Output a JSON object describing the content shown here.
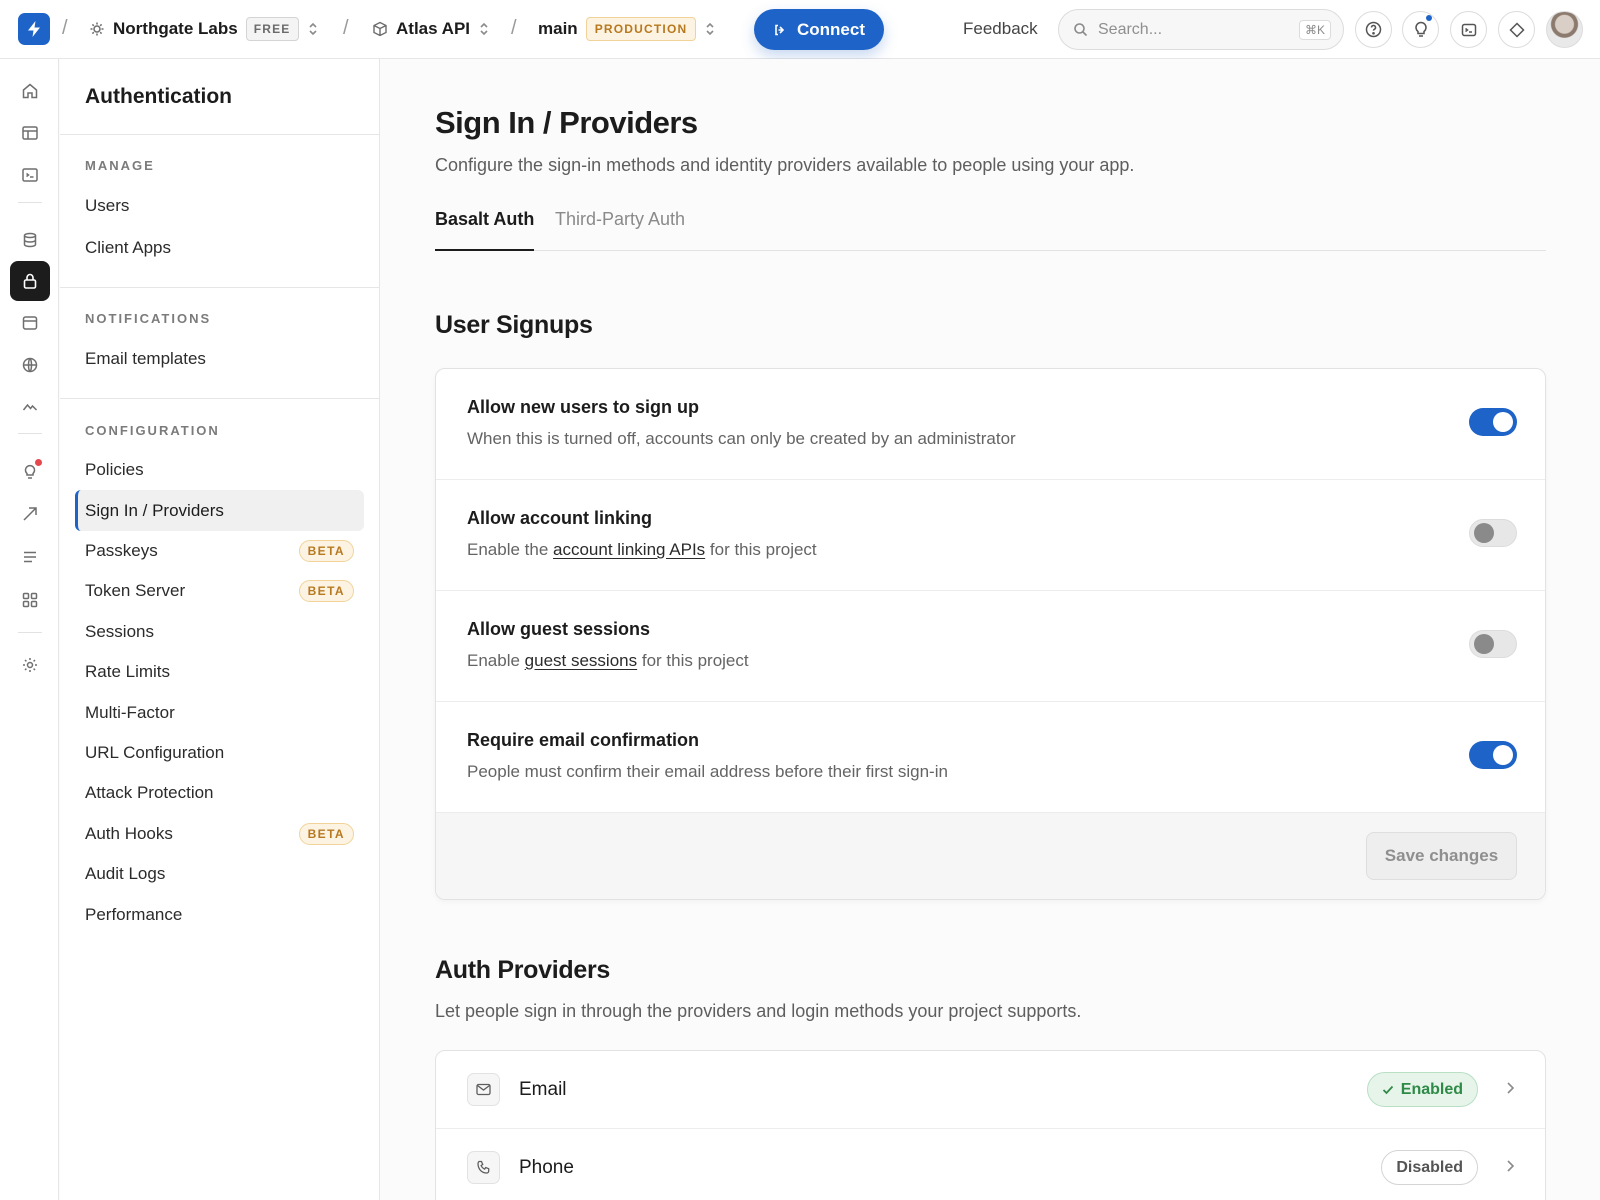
{
  "topbar": {
    "org_name": "Northgate Labs",
    "org_plan": "FREE",
    "project_name": "Atlas API",
    "branch_name": "main",
    "branch_env": "PRODUCTION",
    "connect_label": "Connect",
    "feedback_label": "Feedback",
    "search_placeholder": "Search...",
    "search_shortcut": "⌘K"
  },
  "rail": {
    "items": [
      "home-icon",
      "table-editor-icon",
      "sql-editor-icon",
      "database-icon",
      "auth-lock-icon",
      "storage-icon",
      "edge-functions-icon",
      "realtime-icon",
      "advisors-icon",
      "reports-icon",
      "logs-icon",
      "integrations-icon",
      "settings-icon"
    ],
    "active": "auth-lock-icon"
  },
  "sidebar": {
    "title": "Authentication",
    "sections": [
      {
        "heading": "MANAGE",
        "items": [
          {
            "label": "Users"
          },
          {
            "label": "Client Apps"
          }
        ]
      },
      {
        "heading": "NOTIFICATIONS",
        "items": [
          {
            "label": "Email templates"
          }
        ]
      },
      {
        "heading": "CONFIGURATION",
        "items": [
          {
            "label": "Policies"
          },
          {
            "label": "Sign In / Providers",
            "active": true
          },
          {
            "label": "Passkeys",
            "badge": "BETA"
          },
          {
            "label": "Token Server",
            "badge": "BETA"
          },
          {
            "label": "Sessions"
          },
          {
            "label": "Rate Limits"
          },
          {
            "label": "Multi-Factor"
          },
          {
            "label": "URL Configuration"
          },
          {
            "label": "Attack Protection"
          },
          {
            "label": "Auth Hooks",
            "badge": "BETA"
          },
          {
            "label": "Audit Logs"
          },
          {
            "label": "Performance"
          }
        ]
      }
    ]
  },
  "main": {
    "title": "Sign In / Providers",
    "subtitle": "Configure the sign-in methods and identity providers available to people using your app.",
    "tabs": [
      {
        "label": "Basalt Auth",
        "active": true
      },
      {
        "label": "Third-Party Auth",
        "active": false
      }
    ],
    "signups": {
      "heading": "User Signups",
      "rows": [
        {
          "title": "Allow new users to sign up",
          "desc_before": "When this is turned off, accounts can only be created by an administrator",
          "link": "",
          "desc_after": "",
          "enabled": true
        },
        {
          "title": "Allow account linking",
          "desc_before": "Enable the ",
          "link": "account linking APIs",
          "desc_after": " for this project",
          "enabled": false
        },
        {
          "title": "Allow guest sessions",
          "desc_before": "Enable ",
          "link": "guest sessions",
          "desc_after": " for this project",
          "enabled": false
        },
        {
          "title": "Require email confirmation",
          "desc_before": "People must confirm their email address before their first sign-in",
          "link": "",
          "desc_after": "",
          "enabled": true
        }
      ],
      "save_label": "Save changes"
    },
    "providers": {
      "heading": "Auth Providers",
      "subtitle": "Let people sign in through the providers and login methods your project supports.",
      "items": [
        {
          "name": "Email",
          "icon": "mail-icon",
          "status": "Enabled",
          "enabled": true
        },
        {
          "name": "Phone",
          "icon": "phone-icon",
          "status": "Disabled",
          "enabled": false
        }
      ]
    }
  },
  "colors": {
    "accent": "#1e63c7",
    "beta": "#b7791f",
    "success": "#2f8a47"
  }
}
